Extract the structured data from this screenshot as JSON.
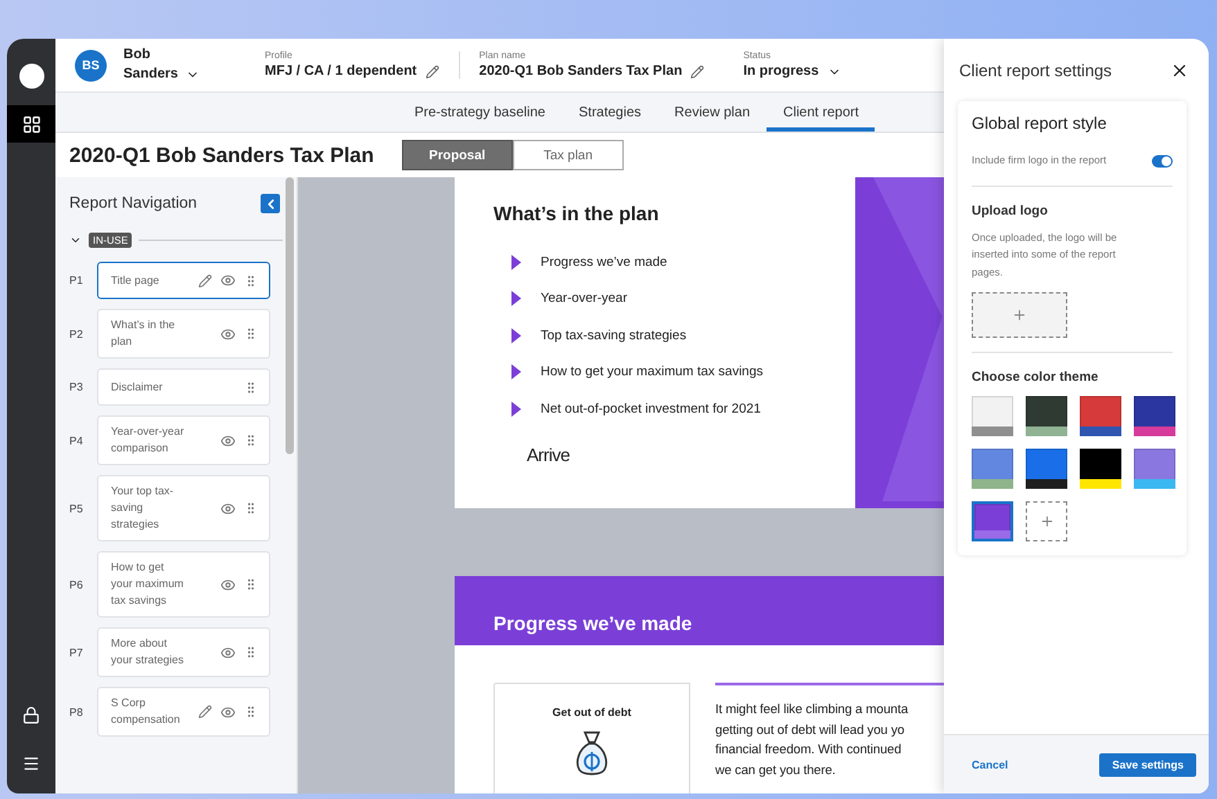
{
  "rail": [
    {
      "kind": "circle",
      "selected": false
    },
    {
      "kind": "grid",
      "selected": true
    },
    {
      "kind": "lock",
      "selected": false
    },
    {
      "kind": "menu",
      "selected": false
    }
  ],
  "header": {
    "user": {
      "initials": "BS",
      "first": "Bob",
      "last": "Sanders"
    },
    "fields": [
      {
        "label": "Profile",
        "value": "MFJ / CA / 1 dependent",
        "kind": "editable"
      },
      {
        "label": "Plan name",
        "value": "2020-Q1 Bob Sanders Tax Plan",
        "kind": "editable"
      },
      {
        "label": "Status",
        "value": "In progress",
        "kind": "dropdown"
      }
    ]
  },
  "tabs": [
    {
      "label": "Pre-strategy baseline",
      "selected": false
    },
    {
      "label": "Strategies",
      "selected": false
    },
    {
      "label": "Review plan",
      "selected": false
    },
    {
      "label": "Client report",
      "selected": true
    }
  ],
  "title": "2020-Q1 Bob Sanders Tax Plan",
  "view_toggle": [
    {
      "label": "Proposal",
      "selected": true
    },
    {
      "label": "Tax plan",
      "selected": false
    }
  ],
  "navigation": {
    "title": "Report Navigation",
    "section": "IN-USE",
    "expanded": true,
    "items": [
      {
        "page": "P1",
        "label": "Title page",
        "editable": true,
        "previewable": true,
        "selected": true
      },
      {
        "page": "P2",
        "label": "What’s in the plan",
        "editable": false,
        "previewable": true,
        "selected": false
      },
      {
        "page": "P3",
        "label": "Disclaimer",
        "editable": false,
        "previewable": false,
        "selected": false
      },
      {
        "page": "P4",
        "label": "Year-over-year comparison",
        "editable": false,
        "previewable": true,
        "selected": false
      },
      {
        "page": "P5",
        "label": "Your top tax-saving strategies",
        "editable": false,
        "previewable": true,
        "selected": false
      },
      {
        "page": "P6",
        "label": "How to get your maximum tax savings",
        "editable": false,
        "previewable": true,
        "selected": false
      },
      {
        "page": "P7",
        "label": "More about your strategies",
        "editable": false,
        "previewable": true,
        "selected": false
      },
      {
        "page": "P8",
        "label": "S Corp compensation",
        "editable": true,
        "previewable": true,
        "selected": false
      }
    ]
  },
  "preview": {
    "plan": {
      "title": "What’s in the plan",
      "items": [
        "Progress we’ve made",
        "Year-over-year",
        "Top tax-saving strategies",
        "How to get your maximum tax savings",
        "Net out-of-pocket investment for 2021"
      ],
      "logo": "Arrive"
    },
    "progress": {
      "title": "Progress we’ve made",
      "card_title": "Get out of debt",
      "lines": [
        "It might feel like climbing a mounta",
        "getting out of debt will lead you yo",
        "financial freedom. With continued",
        "we can get you there."
      ]
    }
  },
  "settings": {
    "title": "Client report settings",
    "section_title": "Global report style",
    "include_logo": {
      "label": "Include firm logo in the report",
      "on": true
    },
    "upload": {
      "title": "Upload logo",
      "text": "Once uploaded, the logo will be inserted into some of the report pages."
    },
    "theme_title": "Choose color theme",
    "themes": [
      {
        "selected": false,
        "bands": [
          {
            "color": "#f2f2f2"
          },
          {
            "color": "#8f8f8f"
          }
        ]
      },
      {
        "selected": false,
        "bands": [
          {
            "color": "#2f3a33"
          },
          {
            "color": "#8fb393"
          }
        ]
      },
      {
        "selected": false,
        "bands": [
          {
            "color": "#d63a3a"
          },
          {
            "color": "#2f55b0"
          }
        ]
      },
      {
        "selected": false,
        "bands": [
          {
            "color": "#2b36a0"
          },
          {
            "color": "#d63a9a"
          }
        ]
      },
      {
        "selected": false,
        "bands": [
          {
            "color": "#6187e0"
          },
          {
            "color": "#8fb38a"
          }
        ]
      },
      {
        "selected": false,
        "bands": [
          {
            "color": "#1a6fe8"
          },
          {
            "color": "#1f1f1f"
          }
        ]
      },
      {
        "selected": false,
        "bands": [
          {
            "color": "#000000"
          },
          {
            "color": "#ffe600"
          }
        ]
      },
      {
        "selected": false,
        "bands": [
          {
            "color": "#8a78e0"
          },
          {
            "color": "#3ab8f0"
          }
        ]
      },
      {
        "selected": true,
        "bands": [
          {
            "color": "#7b3fd8"
          },
          {
            "color": "#9a6ae8"
          }
        ]
      }
    ],
    "cancel": "Cancel",
    "save": "Save settings"
  }
}
